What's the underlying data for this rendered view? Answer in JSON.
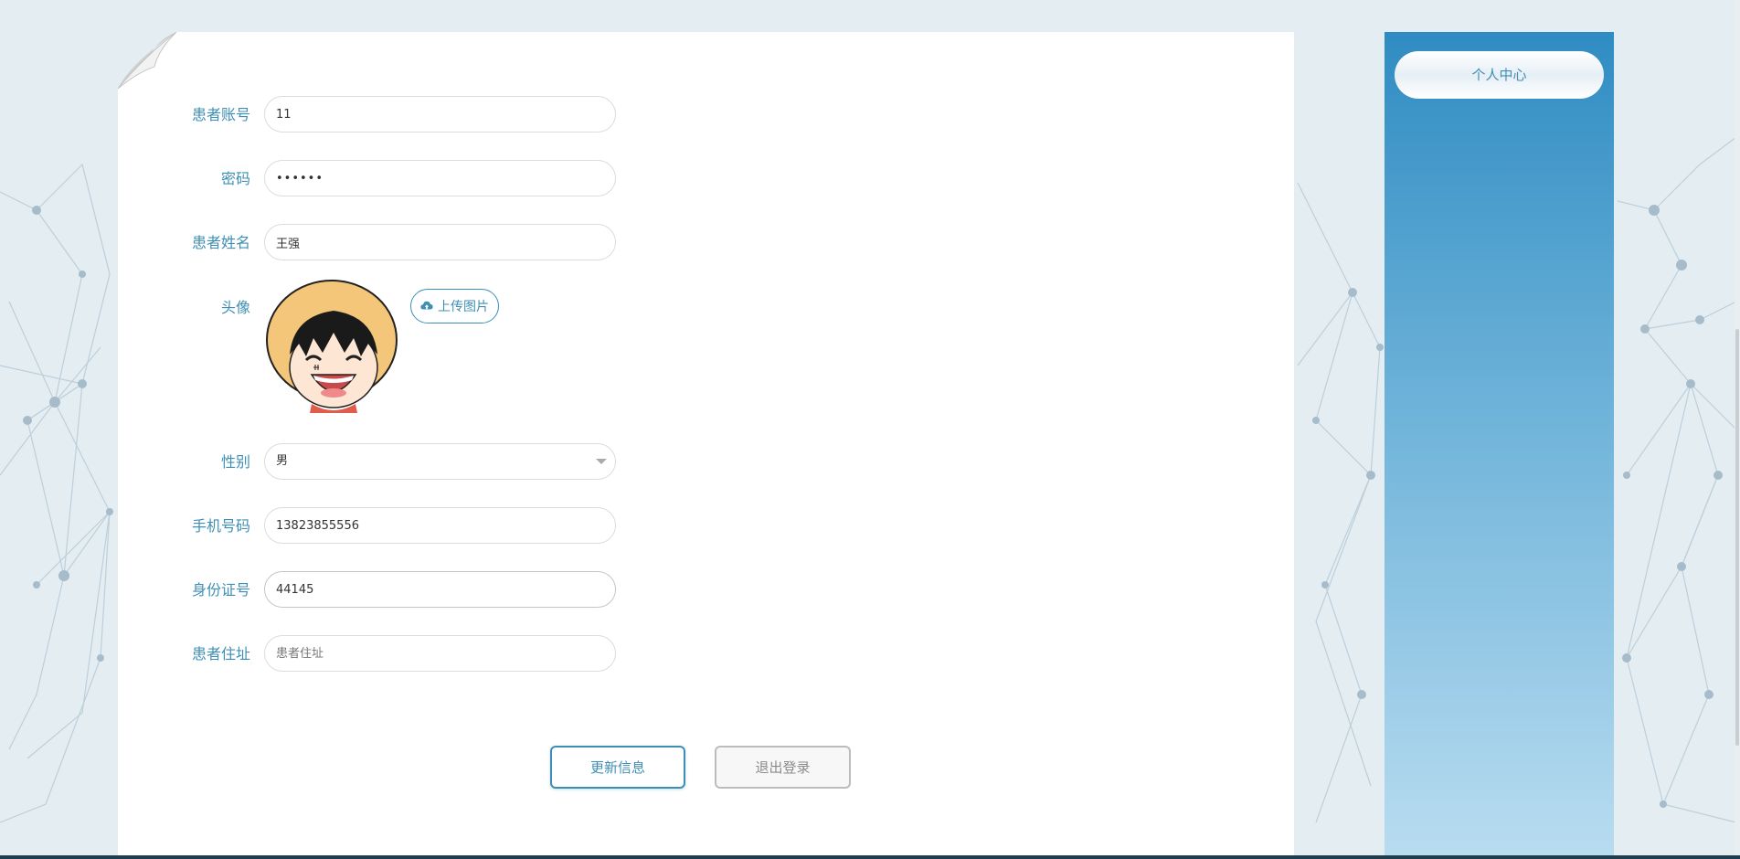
{
  "form": {
    "account": {
      "label": "患者账号",
      "value": "11"
    },
    "password": {
      "label": "密码",
      "value": "••••••"
    },
    "name": {
      "label": "患者姓名",
      "value": "王强"
    },
    "avatar": {
      "label": "头像",
      "upload_label": "上传图片",
      "upload_icon": "cloud-upload-icon"
    },
    "gender": {
      "label": "性别",
      "value": "男"
    },
    "phone": {
      "label": "手机号码",
      "value": "13823855556"
    },
    "id_card": {
      "label": "身份证号",
      "value": "44145"
    },
    "address": {
      "label": "患者住址",
      "value": "",
      "placeholder": "患者住址"
    }
  },
  "buttons": {
    "update": "更新信息",
    "logout": "退出登录"
  },
  "sidebar": {
    "items": [
      {
        "label": "个人中心"
      }
    ]
  },
  "colors": {
    "accent": "#3f8fb4",
    "sidebar_top": "#2f8cc2",
    "sidebar_bottom": "#b8dcf0"
  }
}
